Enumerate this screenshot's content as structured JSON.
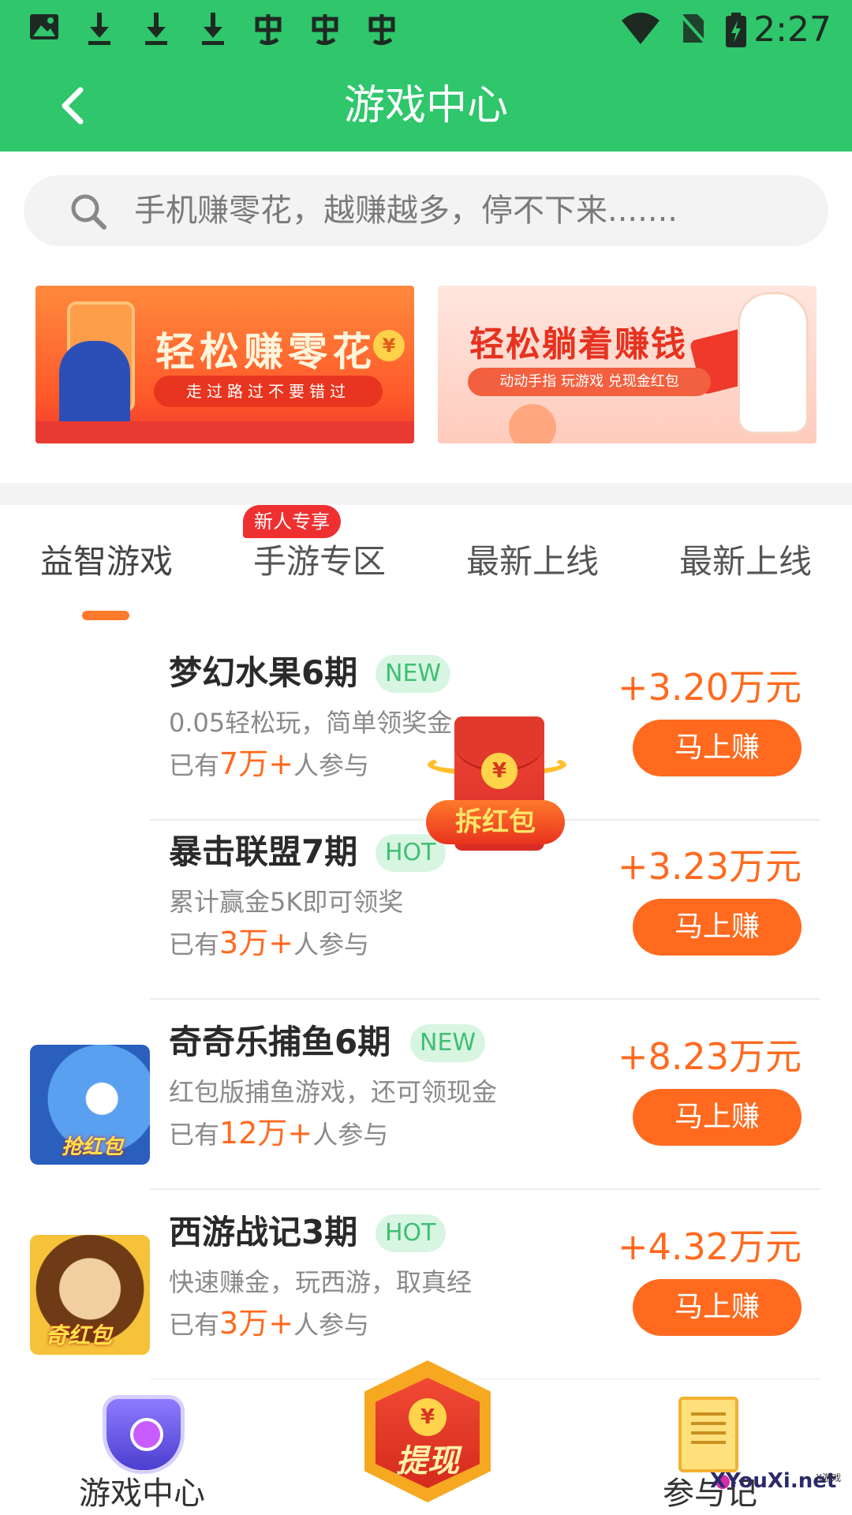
{
  "status_bar": {
    "time": "2:27",
    "icons": [
      "image-icon",
      "download-icon",
      "download-icon",
      "download-icon",
      "app-notification-icon",
      "app-notification-icon",
      "app-notification-icon",
      "wifi-icon",
      "no-sim-icon",
      "battery-charging-icon"
    ]
  },
  "header": {
    "title": "游戏中心"
  },
  "search": {
    "placeholder": "手机赚零花，越赚越多，停不下来......."
  },
  "banners": [
    {
      "title": "轻松赚零花",
      "coin": "¥",
      "subtitle": "走过路过不要错过"
    },
    {
      "title": "轻松躺着赚钱",
      "subtitle": "动动手指 玩游戏 兑现金红包"
    }
  ],
  "tabs": {
    "items": [
      {
        "label": "益智游戏"
      },
      {
        "label": "手游专区"
      },
      {
        "label": "最新上线"
      },
      {
        "label": "最新上线"
      }
    ],
    "badge": "新人专享",
    "active_index": 0
  },
  "games": [
    {
      "name": "梦幻水果6期",
      "tag": "NEW",
      "desc": "0.05轻松玩，简单领奖金",
      "count_prefix": "已有",
      "count": "7万+",
      "count_suffix": "人参与",
      "reward": "+3.20万元",
      "button": "马上赚"
    },
    {
      "name": "暴击联盟7期",
      "tag": "HOT",
      "desc": "累计赢金5K即可领奖",
      "count_prefix": "已有",
      "count": "3万+",
      "count_suffix": "人参与",
      "reward": "+3.23万元",
      "button": "马上赚"
    },
    {
      "name": "奇奇乐捕鱼6期",
      "tag": "NEW",
      "desc": "红包版捕鱼游戏，还可领现金",
      "count_prefix": "已有",
      "count": "12万+",
      "count_suffix": "人参与",
      "reward": "+8.23万元",
      "button": "马上赚",
      "thumb_label": "抢红包"
    },
    {
      "name": "西游战记3期",
      "tag": "HOT",
      "desc": "快速赚金，玩西游，取真经",
      "count_prefix": "已有",
      "count": "3万+",
      "count_suffix": "人参与",
      "reward": "+4.32万元",
      "button": "马上赚",
      "thumb_label": "奇红包"
    }
  ],
  "floating_envelope": {
    "coin": "¥",
    "label": "拆红包"
  },
  "bottom_nav": {
    "game_center": "游戏中心",
    "withdraw": "提现",
    "withdraw_coin": "¥",
    "join": "参与记"
  },
  "watermark": {
    "text": "XYouXi.net",
    "small": "X游戏"
  },
  "colors": {
    "primary_green": "#2fc66c",
    "accent_orange": "#ff6a1f",
    "tag_green": "#3fbf72"
  }
}
